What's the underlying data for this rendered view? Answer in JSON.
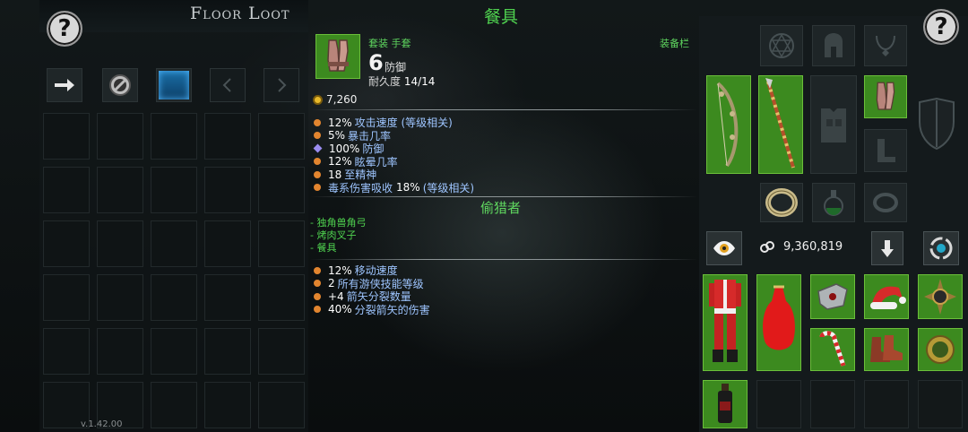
{
  "floor_loot": {
    "title": "Floor Loot",
    "version": "v.1.42.00"
  },
  "tooltip": {
    "item_name": "餐具",
    "item_type": "套装 手套",
    "defense_value": "6",
    "defense_label": "防御",
    "durability_label": "耐久度",
    "durability_value": "14/14",
    "slot_label": "装备栏",
    "gold_value": "7,260",
    "stats": [
      {
        "num": "12%",
        "text": "攻击速度 (等级相关)",
        "bullet": "orange"
      },
      {
        "num": "5%",
        "text": "暴击几率",
        "bullet": "orange"
      },
      {
        "num": "100%",
        "text": "防御",
        "bullet": "purple"
      },
      {
        "num": "12%",
        "text": "眩晕几率",
        "bullet": "orange"
      },
      {
        "num": "18",
        "text": "至精神",
        "bullet": "orange"
      },
      {
        "pre": "毒系伤害吸收",
        "num": "18%",
        "text": "(等级相关)",
        "bullet": "orange"
      }
    ],
    "set_name": "偷猎者",
    "set_items": [
      "- 独角兽角弓",
      "- 烤肉叉子",
      "- 餐具"
    ],
    "set_bonuses": [
      {
        "num": "12%",
        "text": "移动速度"
      },
      {
        "num": "2",
        "text": "所有游侠技能等级"
      },
      {
        "num": "+4",
        "text": "箭矢分裂数量"
      },
      {
        "num": "40%",
        "text": "分裂箭矢的伤害"
      }
    ]
  },
  "equipment": {
    "gold_total": "9,360,819"
  },
  "icons": {
    "help": "?",
    "colors": {
      "set_green": "#4fd14f",
      "stat_blue": "#9ec5ff",
      "bullet_orange": "#e2852f",
      "slot_green": "#3c8a1f"
    }
  }
}
